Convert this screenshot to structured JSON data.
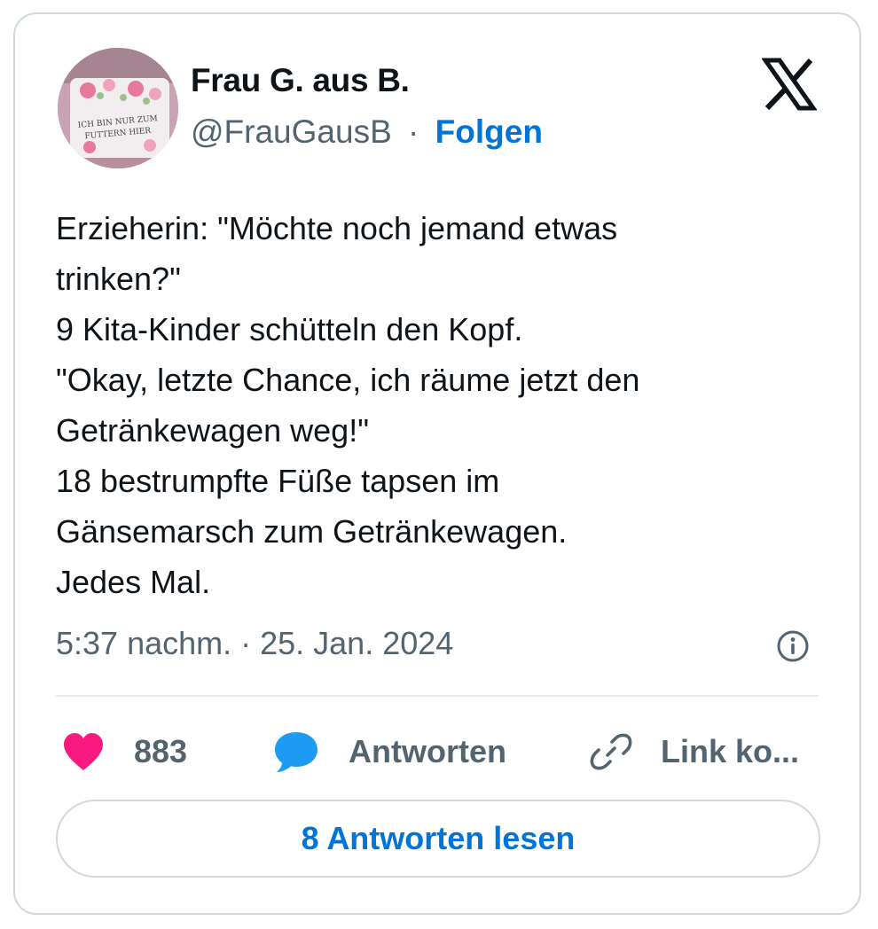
{
  "author": {
    "name": "Frau G. aus B.",
    "handle": "@FrauGausB",
    "separator": "·",
    "follow_label": "Folgen",
    "avatar_caption_lines": [
      "ICH BIN NUR ZUM",
      "FUTTERN HIER"
    ]
  },
  "platform": {
    "logo_icon": "x-logo-icon"
  },
  "tweet": {
    "lines": [
      "Erzieherin: \"Möchte noch jemand etwas",
      "trinken?\"",
      "9 Kita-Kinder schütteln den Kopf.",
      "\"Okay, letzte Chance, ich räume jetzt den",
      "Getränkewagen weg!\"",
      "18 bestrumpfte Füße tapsen im",
      "Gänsemarsch zum Getränkewagen.",
      "Jedes Mal."
    ],
    "timestamp": "5:37 nachm. · 25. Jan. 2024",
    "info_icon": "info-icon"
  },
  "actions": {
    "like_count": "883",
    "like_icon": "heart-icon",
    "reply_label": "Antworten",
    "reply_icon": "speech-bubble-icon",
    "link_label": "Link ko...",
    "link_icon": "link-icon",
    "read_replies_label": "8 Antworten lesen"
  },
  "colors": {
    "like": "#f91880",
    "reply": "#1d9bf0",
    "link_text": "#0074d9",
    "secondary_text": "#536471",
    "border": "#cfd9de"
  }
}
